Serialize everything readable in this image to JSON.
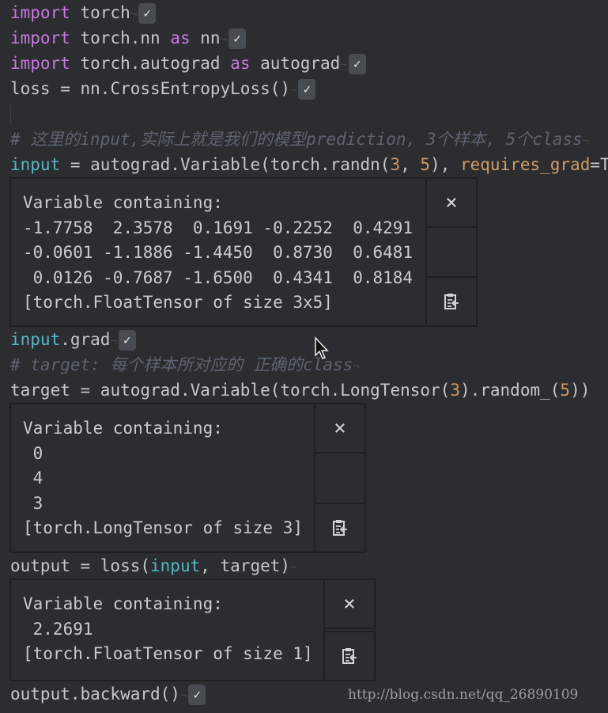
{
  "theme": {
    "background": "#2b2d30",
    "keyword": "#c678dd",
    "builtin": "#56b6c2",
    "number": "#d19a66",
    "comment": "#5c6370",
    "error_underline": "#c0392b"
  },
  "blocks": [
    {
      "type": "code",
      "check": true,
      "tokens": [
        {
          "t": "import",
          "c": "kw"
        },
        {
          "t": " torch"
        }
      ]
    },
    {
      "type": "code",
      "check": true,
      "tokens": [
        {
          "t": "import",
          "c": "kw"
        },
        {
          "t": " "
        },
        {
          "t": "torch.nn",
          "c": "err"
        },
        {
          "t": " "
        },
        {
          "t": "as",
          "c": "kw"
        },
        {
          "t": " "
        },
        {
          "t": "nn",
          "c": "err"
        }
      ]
    },
    {
      "type": "code",
      "check": true,
      "tokens": [
        {
          "t": "import",
          "c": "kw"
        },
        {
          "t": " "
        },
        {
          "t": "torch.autograd",
          "c": "err"
        },
        {
          "t": " "
        },
        {
          "t": "as",
          "c": "kw"
        },
        {
          "t": " "
        },
        {
          "t": "autograd",
          "c": "err"
        }
      ]
    },
    {
      "type": "code",
      "check": true,
      "tokens": [
        {
          "t": "loss = "
        },
        {
          "t": "nn.CrossEntropyLoss()",
          "c": "err"
        }
      ]
    },
    {
      "type": "code",
      "guide": true,
      "tokens": []
    },
    {
      "type": "code",
      "eol": true,
      "tokens": [
        {
          "t": "# 这里的input,实际上就是我们的模型prediction, 3个样本, 5个class",
          "c": "cm"
        }
      ]
    },
    {
      "type": "code",
      "tokens": [
        {
          "t": "input",
          "c": "fn"
        },
        {
          "t": " = "
        },
        {
          "t": "autograd.Variable(torch.randn(",
          "c": "err"
        },
        {
          "t": "3",
          "c": "num"
        },
        {
          "t": ", "
        },
        {
          "t": "5",
          "c": "num"
        },
        {
          "t": "), "
        },
        {
          "t": "requires_grad",
          "c": "arg"
        },
        {
          "t": "=T"
        }
      ]
    },
    {
      "type": "output",
      "width": 592,
      "lines": [
        "Variable containing:",
        "-1.7758  2.3578  0.1691 -0.2252  0.4291",
        "-0.0601 -1.1886 -1.4450  0.8730  0.6481",
        " 0.0126 -0.7687 -1.6500  0.4341  0.8184",
        "[torch.FloatTensor of size 3x5]"
      ]
    },
    {
      "type": "code",
      "check": true,
      "tokens": [
        {
          "t": "input",
          "c": "fn"
        },
        {
          "t": ".grad"
        }
      ]
    },
    {
      "type": "code",
      "eol": true,
      "tokens": [
        {
          "t": "# target: 每个样本所对应的 正确的class",
          "c": "cm"
        }
      ]
    },
    {
      "type": "code",
      "tokens": [
        {
          "t": "target = "
        },
        {
          "t": "autograd.Variable",
          "c": "err"
        },
        {
          "t": "(torch.LongTensor("
        },
        {
          "t": "3",
          "c": "num"
        },
        {
          "t": ").random_("
        },
        {
          "t": "5",
          "c": "num"
        },
        {
          "t": "))"
        }
      ]
    },
    {
      "type": "output",
      "width": 451,
      "lines": [
        "Variable containing:",
        " 0",
        " 4",
        " 3",
        "[torch.LongTensor of size 3]"
      ]
    },
    {
      "type": "code",
      "eol": true,
      "tokens": [
        {
          "t": "output = loss("
        },
        {
          "t": "input",
          "c": "fn"
        },
        {
          "t": ", target)"
        }
      ]
    },
    {
      "type": "output",
      "width": 463,
      "lines": [
        "Variable containing:",
        " 2.2691",
        "[torch.FloatTensor of size 1]"
      ]
    },
    {
      "type": "code",
      "check": true,
      "tokens": [
        {
          "t": "output.backward()"
        }
      ]
    }
  ],
  "output_buttons": {
    "close": "×"
  },
  "check_glyph": "✓",
  "watermark": "http://blog.csdn.net/qq_26890109"
}
